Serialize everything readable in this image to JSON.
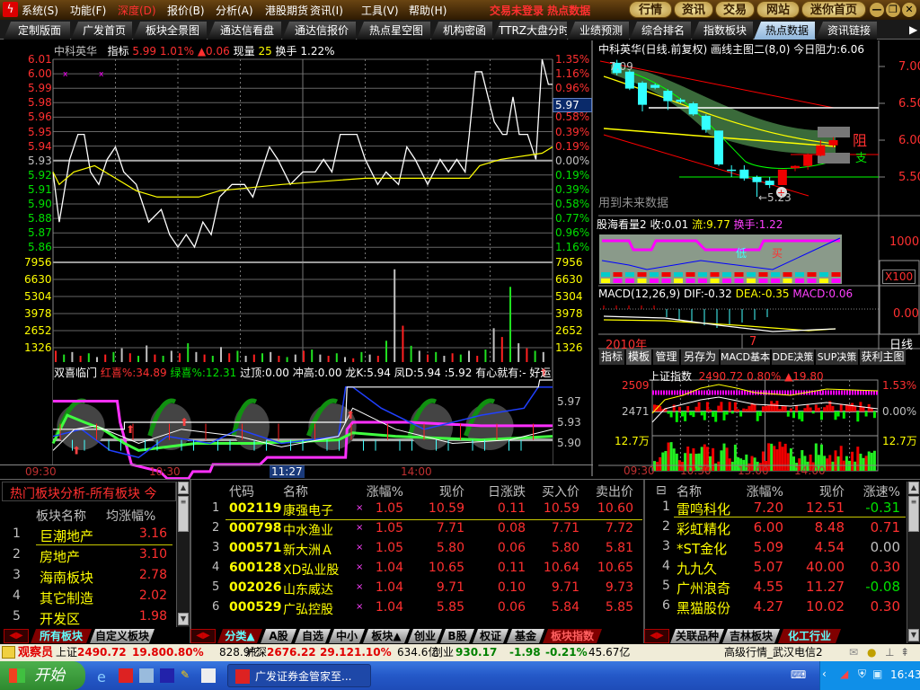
{
  "menubar": {
    "items": [
      "系统(S)",
      "功能(F)",
      "深度(D)",
      "报价(B)",
      "分析(A)",
      "港股期货",
      "资讯(I)",
      "工具(V)",
      "帮助(H)"
    ],
    "status": "交易未登录 热点数据",
    "buttons": [
      "行情",
      "资讯",
      "交易",
      "网站",
      "迷你首页"
    ],
    "window": [
      "—",
      "❐",
      "✕"
    ]
  },
  "tabs": [
    "定制版面",
    "广发首页",
    "板块全景图",
    "通达信看盘",
    "通达信报价",
    "热点星空图",
    "机构密函",
    "TTRZ大盘分时",
    "业绩预测",
    "综合排名",
    "指数板块",
    "热点数据",
    "资讯链接"
  ],
  "active_tab": "热点数据",
  "intraday": {
    "name": "中科英华",
    "label_indicator": "指标",
    "price": "5.99",
    "pct": "1.01%",
    "change": "▲0.06",
    "label_volume": "现量",
    "volume": "25",
    "label_turnover": "换手",
    "turnover": "1.22%",
    "price_axis": [
      "6.01",
      "6.00",
      "5.99",
      "5.98",
      "5.96",
      "5.95",
      "5.94",
      "5.93",
      "5.92",
      "5.91",
      "5.90",
      "5.88",
      "5.87",
      "5.86"
    ],
    "pct_axis": [
      "1.35%",
      "1.16%",
      "0.96%",
      "0.77%",
      "0.58%",
      "0.39%",
      "0.19%",
      "0.00%",
      "0.19%",
      "0.39%",
      "0.58%",
      "0.77%",
      "0.96%",
      "1.16%"
    ],
    "cursor_price": "5.97",
    "volume_axis": [
      "7956",
      "6630",
      "5304",
      "3978",
      "2652",
      "1326"
    ],
    "chart_data": {
      "type": "line",
      "x_unit": "minutes since 09:30",
      "prev_close": 5.93,
      "ylim": [
        5.86,
        6.01
      ],
      "price": [
        [
          0,
          5.92
        ],
        [
          3,
          5.88
        ],
        [
          5,
          5.9
        ],
        [
          8,
          5.93
        ],
        [
          12,
          5.95
        ],
        [
          15,
          5.95
        ],
        [
          18,
          5.92
        ],
        [
          22,
          5.91
        ],
        [
          26,
          5.93
        ],
        [
          30,
          5.94
        ],
        [
          34,
          5.92
        ],
        [
          40,
          5.91
        ],
        [
          46,
          5.88
        ],
        [
          52,
          5.89
        ],
        [
          56,
          5.87
        ],
        [
          60,
          5.86
        ],
        [
          64,
          5.87
        ],
        [
          68,
          5.86
        ],
        [
          72,
          5.88
        ],
        [
          76,
          5.87
        ],
        [
          80,
          5.9
        ],
        [
          86,
          5.91
        ],
        [
          92,
          5.91
        ],
        [
          96,
          5.9
        ],
        [
          100,
          5.92
        ],
        [
          104,
          5.94
        ],
        [
          108,
          5.93
        ],
        [
          114,
          5.91
        ],
        [
          120,
          5.92
        ],
        [
          126,
          5.92
        ],
        [
          130,
          5.93
        ],
        [
          134,
          5.92
        ],
        [
          138,
          5.95
        ],
        [
          146,
          5.95
        ],
        [
          150,
          5.93
        ],
        [
          156,
          5.91
        ],
        [
          160,
          5.92
        ],
        [
          166,
          5.91
        ],
        [
          170,
          5.94
        ],
        [
          174,
          5.93
        ],
        [
          180,
          5.91
        ],
        [
          186,
          5.93
        ],
        [
          190,
          5.92
        ],
        [
          194,
          5.93
        ],
        [
          198,
          5.92
        ],
        [
          200,
          5.95
        ],
        [
          203,
          6.0
        ],
        [
          206,
          6.0
        ],
        [
          209,
          5.98
        ],
        [
          212,
          5.96
        ],
        [
          216,
          5.95
        ],
        [
          218,
          5.95
        ],
        [
          221,
          5.98
        ],
        [
          224,
          5.95
        ],
        [
          228,
          5.95
        ],
        [
          232,
          5.93
        ],
        [
          235,
          6.01
        ],
        [
          238,
          5.99
        ],
        [
          240,
          5.99
        ]
      ],
      "avg_price": [
        [
          0,
          5.92
        ],
        [
          3,
          5.91
        ],
        [
          10,
          5.92
        ],
        [
          20,
          5.925
        ],
        [
          30,
          5.915
        ],
        [
          40,
          5.905
        ],
        [
          50,
          5.9
        ],
        [
          70,
          5.9
        ],
        [
          80,
          5.905
        ],
        [
          110,
          5.91
        ],
        [
          150,
          5.915
        ],
        [
          180,
          5.915
        ],
        [
          200,
          5.915
        ],
        [
          205,
          5.925
        ],
        [
          215,
          5.93
        ],
        [
          235,
          5.935
        ],
        [
          240,
          5.94
        ]
      ],
      "volume": [
        900,
        600,
        800,
        500,
        700,
        400,
        600,
        800,
        1100,
        700,
        500,
        1326,
        600,
        500,
        900,
        700,
        1500,
        800,
        600,
        500,
        1200,
        700,
        900,
        500,
        600,
        700,
        800,
        500,
        400,
        600,
        900,
        1000,
        600,
        500,
        700,
        400,
        300,
        800,
        600,
        500,
        1700,
        7400,
        2900,
        1300,
        900,
        600,
        800,
        500,
        700,
        600,
        900,
        500,
        1000,
        2700,
        2000,
        6000,
        1500,
        1100,
        900,
        800
      ]
    }
  },
  "indicator": {
    "name": "双喜临门",
    "items": [
      "红喜%:34.89",
      "绿喜%:12.31",
      "过顶:0.00",
      "冲高:0.00",
      "龙K:5.94",
      "凤D:5.94",
      ":5.92",
      "有心就有:-",
      "好运"
    ],
    "axis": [
      "5.97",
      "5.93",
      "5.90"
    ]
  },
  "time_axis": [
    "09:30",
    "10:30",
    "11:27",
    "14:00"
  ],
  "daily": {
    "title": "中科英华(日线.前复权) 画线主图二(8,0) 今日阻力:6.06",
    "high_label": "7.09",
    "low_label": "←5.23",
    "note": "用到未来数据",
    "resist": "阻",
    "support": "支",
    "axis": [
      "7.00",
      "6.50",
      "6.00",
      "5.50"
    ],
    "chart_data": {
      "type": "candlestick",
      "ylim": [
        5.2,
        7.15
      ],
      "ohlc": [
        [
          7.05,
          6.91,
          7.09,
          6.88
        ],
        [
          6.93,
          6.7,
          6.95,
          6.68
        ],
        [
          6.78,
          6.48,
          6.8,
          6.39
        ],
        [
          6.75,
          6.71,
          6.77,
          6.69
        ],
        [
          6.67,
          6.53,
          6.69,
          6.41
        ],
        [
          6.55,
          6.52,
          6.57,
          6.5
        ],
        [
          6.5,
          6.35,
          6.52,
          6.33
        ],
        [
          6.33,
          6.14,
          6.35,
          6.1
        ],
        [
          6.13,
          5.67,
          6.13,
          5.65
        ],
        [
          5.6,
          5.6,
          5.66,
          5.5
        ],
        [
          5.6,
          5.48,
          5.66,
          5.45
        ],
        [
          5.5,
          5.43,
          5.52,
          5.23
        ],
        [
          5.45,
          5.39,
          5.5,
          5.35
        ],
        [
          5.39,
          5.6,
          5.6,
          5.39
        ],
        [
          5.62,
          5.65,
          5.66,
          5.58
        ],
        [
          5.65,
          5.8,
          5.82,
          5.6
        ],
        [
          5.79,
          5.93,
          6.0,
          5.78
        ],
        [
          5.93,
          6.0,
          6.04,
          5.9
        ]
      ]
    }
  },
  "volume_panel": {
    "name": "股海看量2",
    "close": "收:0.01",
    "flow": "流:9.77",
    "turnover": "换手:1.22",
    "axis": "10000",
    "scale": "X100",
    "low": "低",
    "buy": "买"
  },
  "macd": {
    "name": "MACD(12,26,9)",
    "dif": "DIF:-0.32",
    "dea": "DEA:-0.35",
    "macd": "MACD:0.06",
    "axis": "0.00"
  },
  "date_row": {
    "year": "2010年",
    "month": "7",
    "period": "日线"
  },
  "ktabs": [
    "指标",
    "模板",
    "管理",
    "另存为",
    "MACD基本",
    "DDE决策",
    "SUP决策",
    "获利主图"
  ],
  "index": {
    "name": "上证指数",
    "value": "2490.72",
    "pct": "0.80%",
    "change": "▲19.80",
    "left_axis": [
      "2509",
      "2471",
      "12.7万"
    ],
    "right_axis": [
      "1.53%",
      "0.00%",
      "12.7万"
    ],
    "times": [
      "09:30",
      "10:30",
      "13:00",
      "14:00"
    ]
  },
  "sector_panel": {
    "title": "热门板块分析-所有板块 今",
    "headers": [
      "板块名称",
      "均涨幅%"
    ],
    "rows": [
      {
        "n": "1",
        "name": "巨潮地产",
        "v": "3.16"
      },
      {
        "n": "2",
        "name": "房地产",
        "v": "3.10"
      },
      {
        "n": "3",
        "name": "海南板块",
        "v": "2.78"
      },
      {
        "n": "4",
        "name": "其它制造",
        "v": "2.02"
      },
      {
        "n": "5",
        "name": "开发区",
        "v": "1.98"
      }
    ],
    "tabs": [
      "所有板块",
      "自定义板块"
    ]
  },
  "stock_table": {
    "headers": [
      "代码",
      "名称",
      "涨幅%",
      "现价",
      "日涨跌",
      "买入价",
      "卖出价"
    ],
    "rows": [
      {
        "n": "1",
        "code": "002119",
        "name": "康强电子",
        "pct": "1.05",
        "price": "10.59",
        "chg": "0.11",
        "bid": "10.59",
        "ask": "10.60"
      },
      {
        "n": "2",
        "code": "000798",
        "name": "中水渔业",
        "pct": "1.05",
        "price": "7.71",
        "chg": "0.08",
        "bid": "7.71",
        "ask": "7.72"
      },
      {
        "n": "3",
        "code": "000571",
        "name": "新大洲Ａ",
        "pct": "1.05",
        "price": "5.80",
        "chg": "0.06",
        "bid": "5.80",
        "ask": "5.81"
      },
      {
        "n": "4",
        "code": "600128",
        "name": "XD弘业股",
        "pct": "1.04",
        "price": "10.65",
        "chg": "0.11",
        "bid": "10.64",
        "ask": "10.65"
      },
      {
        "n": "5",
        "code": "002026",
        "name": "山东威达",
        "pct": "1.04",
        "price": "9.71",
        "chg": "0.10",
        "bid": "9.71",
        "ask": "9.73"
      },
      {
        "n": "6",
        "code": "000529",
        "name": "广弘控股",
        "pct": "1.04",
        "price": "5.85",
        "chg": "0.06",
        "bid": "5.84",
        "ask": "5.85"
      }
    ],
    "tabs": [
      "分类▲",
      "A股",
      "自选",
      "中小",
      "板块▲",
      "创业",
      "B股",
      "权证",
      "基金",
      "板块指数"
    ]
  },
  "related_table": {
    "headers": [
      "名称",
      "涨幅%",
      "现价",
      "涨速%"
    ],
    "rows": [
      {
        "n": "1",
        "name": "雷鸣科化",
        "pct": "7.20",
        "price": "12.51",
        "speed": "-0.31"
      },
      {
        "n": "2",
        "name": "彩虹精化",
        "pct": "6.00",
        "price": "8.48",
        "speed": "0.71"
      },
      {
        "n": "3",
        "name": "*ST金化",
        "pct": "5.09",
        "price": "4.54",
        "speed": "0.00"
      },
      {
        "n": "4",
        "name": "九九久",
        "pct": "5.07",
        "price": "40.00",
        "speed": "0.30"
      },
      {
        "n": "5",
        "name": "广州浪奇",
        "pct": "4.55",
        "price": "11.27",
        "speed": "-0.08"
      },
      {
        "n": "6",
        "name": "黑猫股份",
        "pct": "4.27",
        "price": "10.02",
        "speed": "0.30"
      }
    ],
    "tabs": [
      "关联品种",
      "吉林板块",
      "化工行业"
    ]
  },
  "statusbar": {
    "observer": "观察员",
    "sh_label": "上证",
    "sh": "2490.72",
    "sh_chg": "19.80",
    "sh_pct": "0.80%",
    "sh_amt": "828.9亿",
    "hs_label": "沪深",
    "hs": "2676.22",
    "hs_chg": "29.12",
    "hs_pct": "1.10%",
    "hs_amt": "634.6亿",
    "cy_label": "创业",
    "cy": "930.17",
    "cy_chg": "-1.98",
    "cy_pct": "-0.21%",
    "cy_amt": "45.67亿",
    "server": "高级行情_武汉电信2"
  },
  "taskbar": {
    "start": "开始",
    "task": "广发证券金管家至...",
    "clock": "16:43"
  },
  "colors": {
    "up": "#ff3030",
    "down": "#00e000",
    "accent": "#ffff00",
    "background": "#000000"
  }
}
